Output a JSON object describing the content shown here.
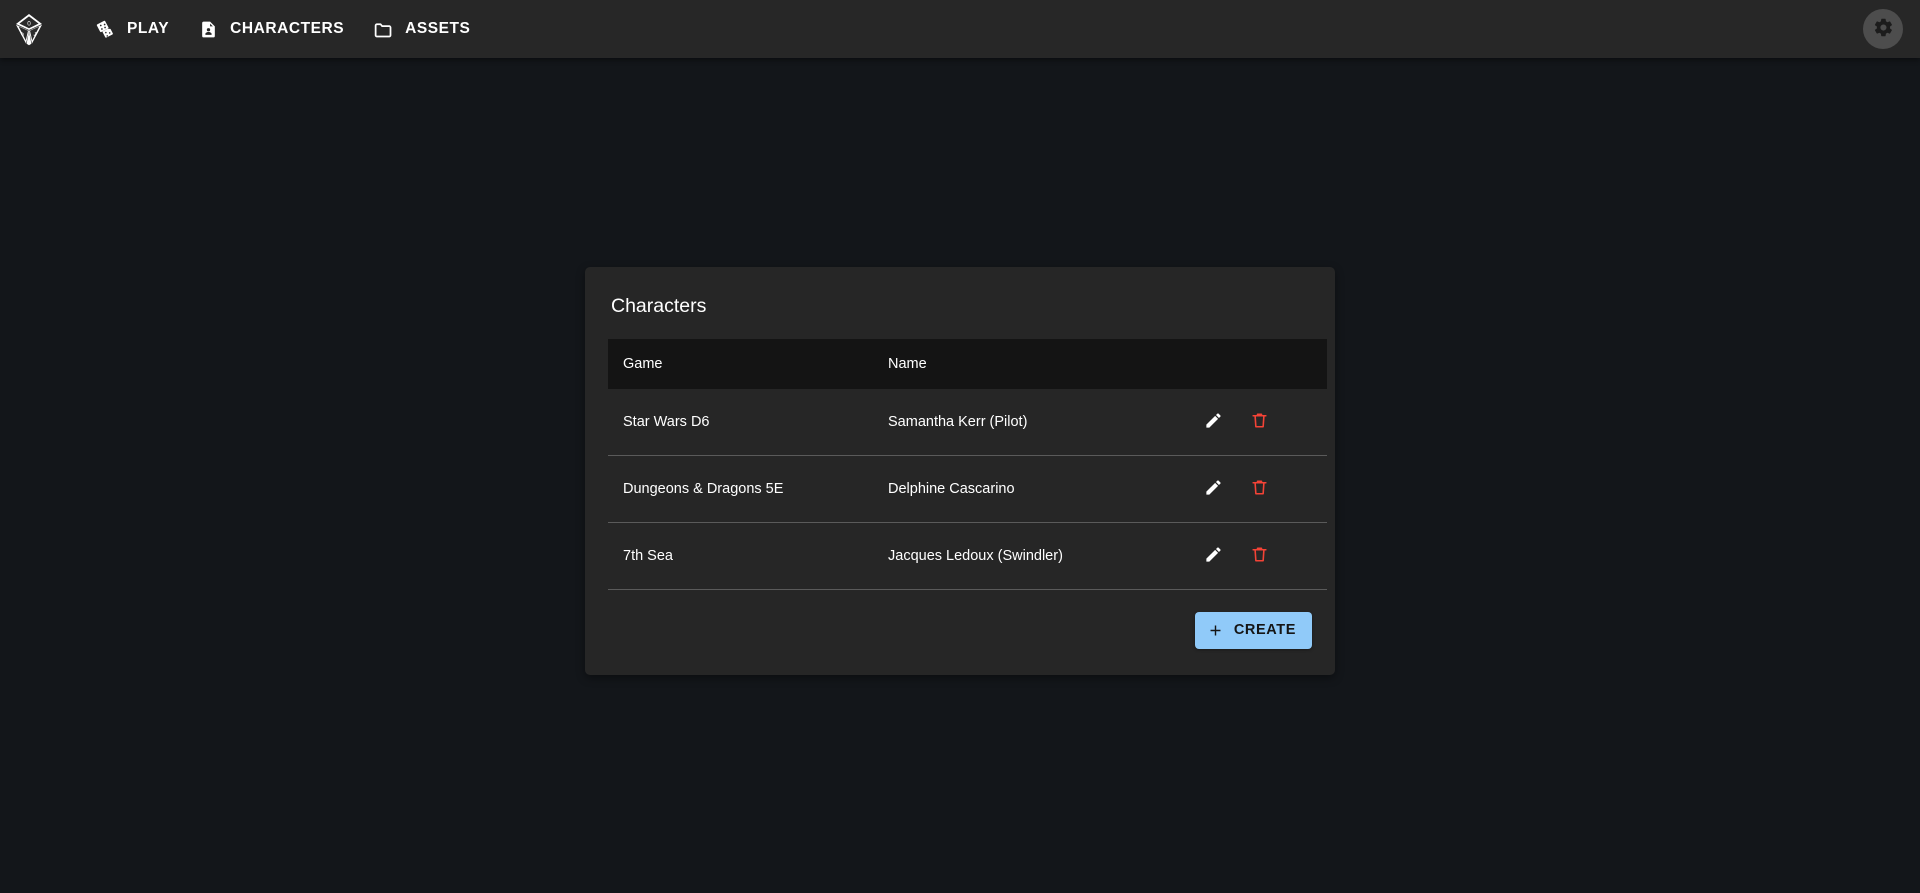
{
  "app": {
    "logo_icon": "d10-die-icon",
    "background_color": "#13161a",
    "navbar_color": "#272727",
    "card_color": "#262626",
    "accent_color": "#90caf9",
    "delete_color": "#f44336"
  },
  "navbar": {
    "items": [
      {
        "label": "PLAY",
        "icon": "dice-icon"
      },
      {
        "label": "CHARACTERS",
        "icon": "character-sheet-icon"
      },
      {
        "label": "ASSETS",
        "icon": "folder-icon"
      }
    ],
    "settings_icon": "gear-icon"
  },
  "card": {
    "title": "Characters",
    "table": {
      "columns": [
        "Game",
        "Name",
        ""
      ],
      "rows": [
        {
          "game": "Star Wars D6",
          "name": "Samantha Kerr (Pilot)",
          "edit_icon": "pencil-icon",
          "delete_icon": "trash-icon"
        },
        {
          "game": "Dungeons & Dragons 5E",
          "name": "Delphine Cascarino",
          "edit_icon": "pencil-icon",
          "delete_icon": "trash-icon"
        },
        {
          "game": "7th Sea",
          "name": "Jacques Ledoux (Swindler)",
          "edit_icon": "pencil-icon",
          "delete_icon": "trash-icon"
        }
      ]
    },
    "create_button": {
      "label": "CREATE",
      "icon": "plus-icon"
    }
  }
}
